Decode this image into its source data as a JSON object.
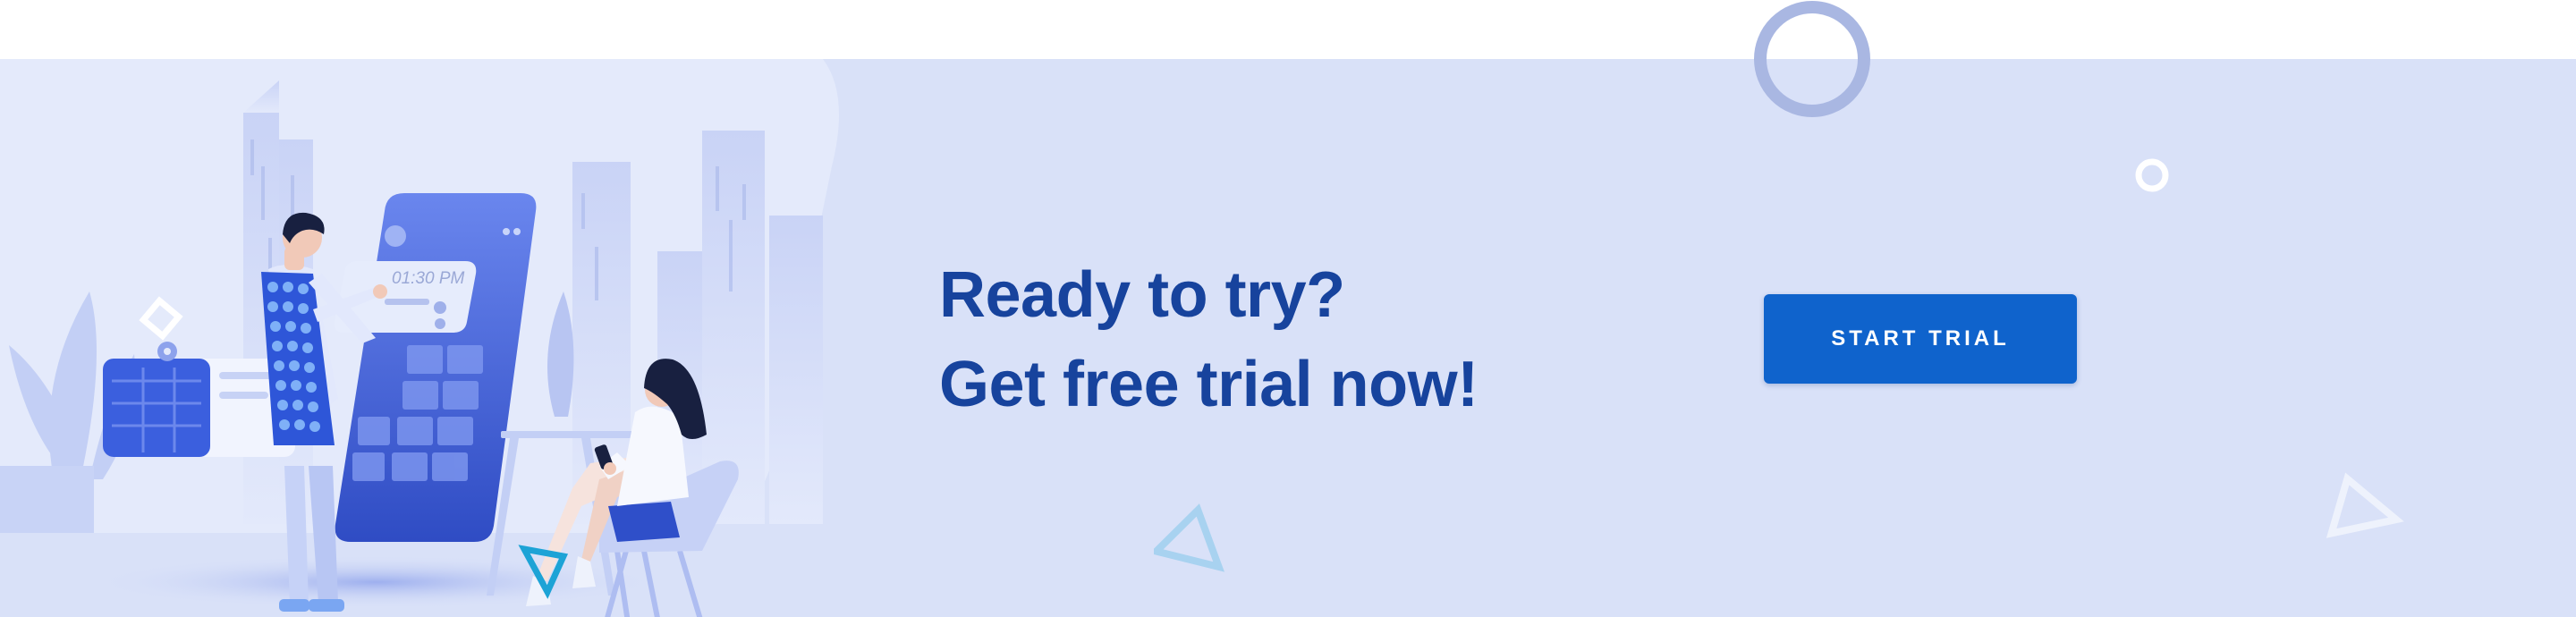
{
  "banner": {
    "headline_line1": "Ready to try?",
    "headline_line2": "Get free trial now!",
    "cta_label": "START TRIAL"
  },
  "illustration": {
    "phone_time": "01:30 PM"
  },
  "colors": {
    "band_background": "#d9e1f8",
    "headline": "#17439d",
    "cta_background": "#0f63cc",
    "cta_text": "#ffffff"
  }
}
